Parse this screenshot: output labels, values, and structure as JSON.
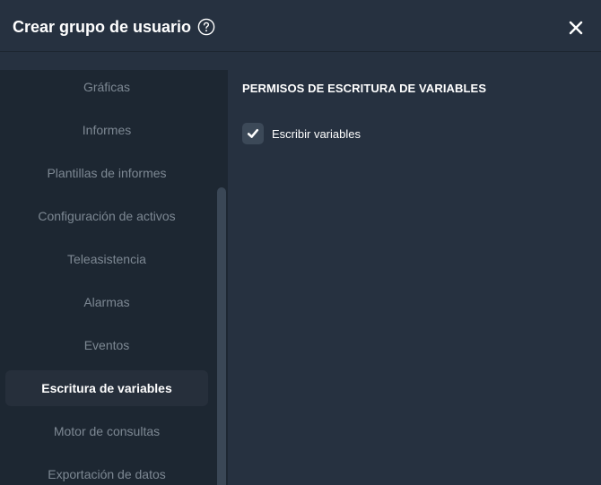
{
  "dialog": {
    "title": "Crear grupo de usuario",
    "help_icon": "question-circle-icon",
    "close_icon": "close-x-icon"
  },
  "sidebar": {
    "items": [
      {
        "label": "Gráficas",
        "active": false
      },
      {
        "label": "Informes",
        "active": false
      },
      {
        "label": "Plantillas de informes",
        "active": false
      },
      {
        "label": "Configuración de activos",
        "active": false
      },
      {
        "label": "Teleasistencia",
        "active": false
      },
      {
        "label": "Alarmas",
        "active": false
      },
      {
        "label": "Eventos",
        "active": false
      },
      {
        "label": "Escritura de variables",
        "active": true
      },
      {
        "label": "Motor de consultas",
        "active": false
      },
      {
        "label": "Exportación de datos",
        "active": false
      }
    ]
  },
  "content": {
    "section_title": "PERMISOS DE ESCRITURA DE VARIABLES",
    "permissions": [
      {
        "label": "Escribir variables",
        "checked": true
      }
    ]
  },
  "colors": {
    "background": "#263140",
    "sidebar": "#1d2732",
    "active_item": "#262f3b",
    "checkbox": "#3c4958",
    "text_primary": "#ffffff",
    "text_muted": "#7d8893"
  }
}
